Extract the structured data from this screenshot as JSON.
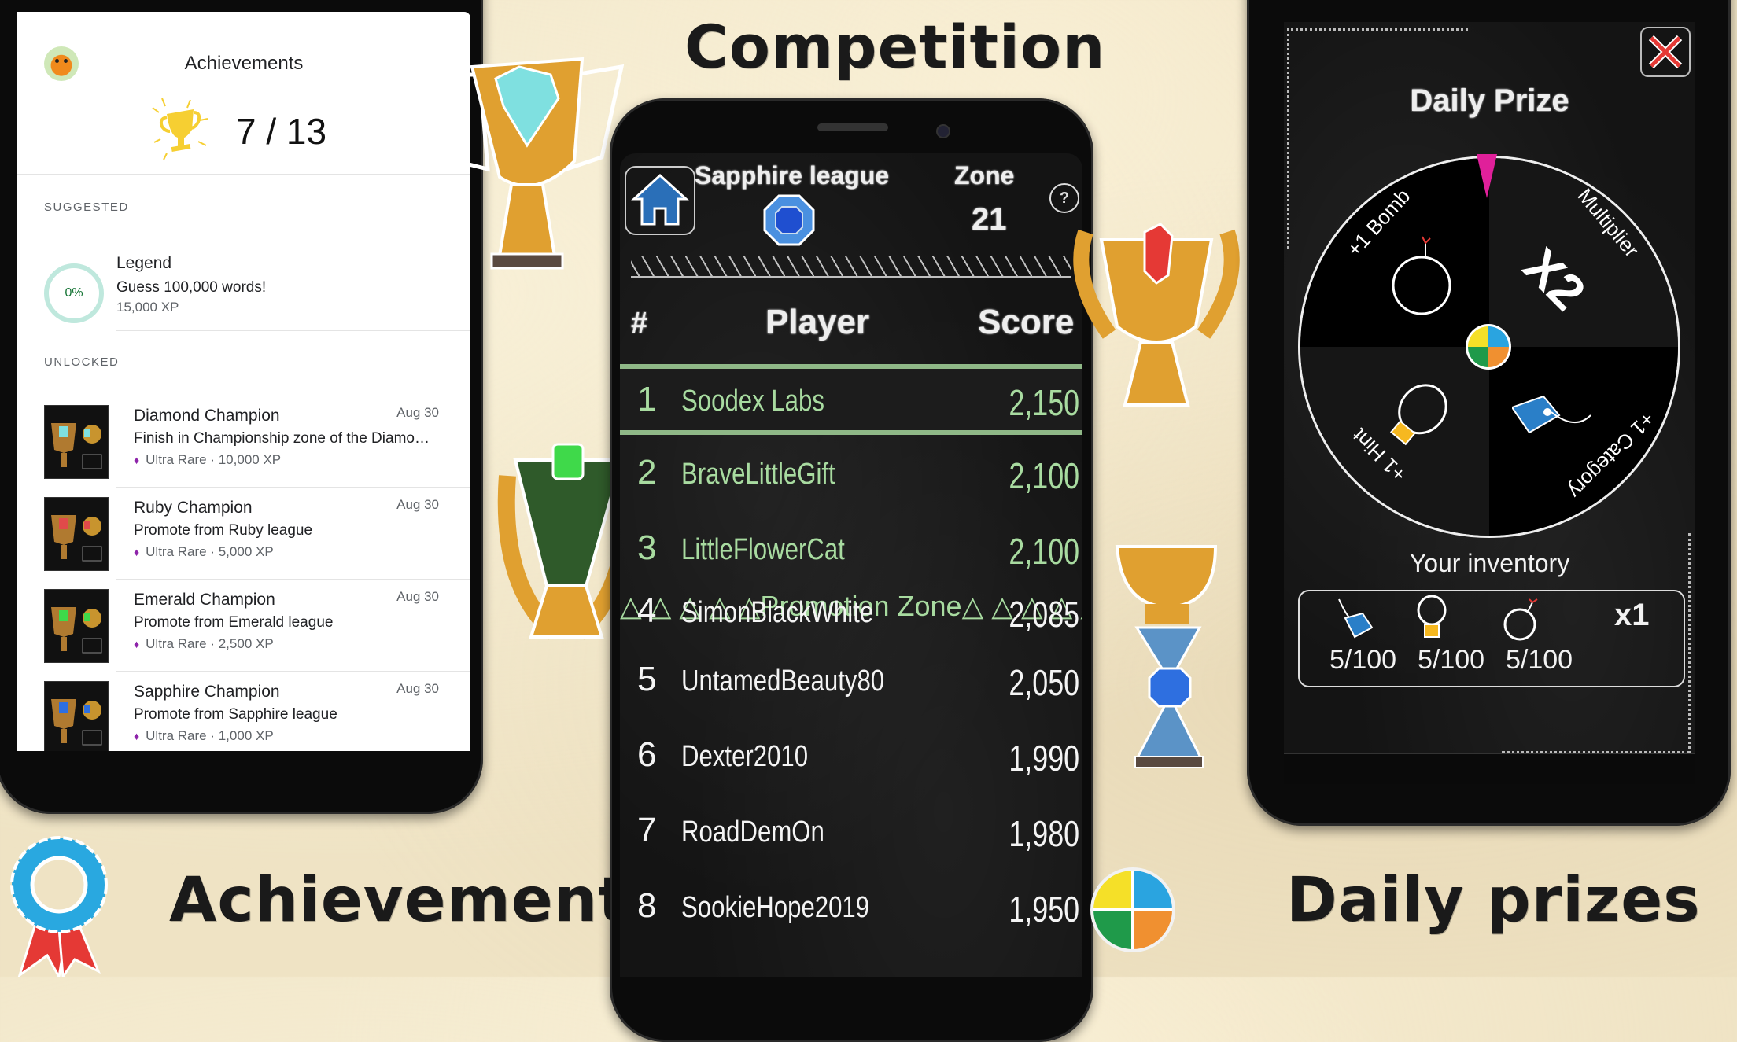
{
  "titles": {
    "competition": "Competition",
    "achievements": "Achievements",
    "daily_prizes": "Daily prizes"
  },
  "achievements_screen": {
    "header_title": "Achievements",
    "avatar_icon": "dragon-avatar",
    "unlocked_count": "7 / 13",
    "trophy_icon": "gold-trophy",
    "sections": {
      "suggested_label": "SUGGESTED",
      "unlocked_label": "UNLOCKED"
    },
    "suggested": {
      "progress_label": "0%",
      "progress_value": 0,
      "name": "Legend",
      "description": "Guess 100,000 words!",
      "xp": "15,000 XP"
    },
    "unlocked": [
      {
        "name": "Diamond Champion",
        "description": "Finish in Championship zone of the Diamo…",
        "meta": "Ultra Rare · 10,000 XP",
        "date": "Aug 30",
        "gem_color": "#7fe0e0"
      },
      {
        "name": "Ruby Champion",
        "description": "Promote from Ruby league",
        "meta": "Ultra Rare · 5,000 XP",
        "date": "Aug 30",
        "gem_color": "#e04a4a"
      },
      {
        "name": "Emerald Champion",
        "description": "Promote from Emerald league",
        "meta": "Ultra Rare · 2,500 XP",
        "date": "Aug 30",
        "gem_color": "#3fd94a"
      },
      {
        "name": "Sapphire Champion",
        "description": "Promote from Sapphire league",
        "meta": "Ultra Rare · 1,000 XP",
        "date": "Aug 30",
        "gem_color": "#2e6fe0"
      }
    ],
    "rarity_color": "#8e24aa"
  },
  "leaderboard_screen": {
    "league": "Sapphire league",
    "zone_label": "Zone",
    "zone_value": "21",
    "help_label": "?",
    "columns": {
      "rank": "#",
      "player": "Player",
      "score": "Score"
    },
    "promotion_zone_label": "△ △ △ △ △Promotion Zone△ △ △ △ △",
    "rows": [
      {
        "rank": "1",
        "player": "Soodex Labs",
        "score": "2,150",
        "highlight": true,
        "promoted": true
      },
      {
        "rank": "2",
        "player": "BraveLittleGift",
        "score": "2,100",
        "highlight": false,
        "promoted": true
      },
      {
        "rank": "3",
        "player": "LittleFlowerCat",
        "score": "2,100",
        "highlight": false,
        "promoted": true
      },
      {
        "rank": "4",
        "player": "SimonBlackWhite",
        "score": "2,085",
        "highlight": false,
        "promoted": false
      },
      {
        "rank": "5",
        "player": "UntamedBeauty80",
        "score": "2,050",
        "highlight": false,
        "promoted": false
      },
      {
        "rank": "6",
        "player": "Dexter2010",
        "score": "1,990",
        "highlight": false,
        "promoted": false
      },
      {
        "rank": "7",
        "player": "RoadDemOn",
        "score": "1,980",
        "highlight": false,
        "promoted": false
      },
      {
        "rank": "8",
        "player": "SookieHope2019",
        "score": "1,950",
        "highlight": false,
        "promoted": false
      }
    ],
    "accent_green": "#a8dba0"
  },
  "daily_prize_screen": {
    "title": "Daily Prize",
    "close_icon": "close-x",
    "wheel": {
      "segments": [
        {
          "label": "+1 Bomb",
          "icon": "bomb"
        },
        {
          "label": "Multiplier",
          "icon": "x2",
          "icon_text": "X2"
        },
        {
          "label": "+1 Category",
          "icon": "tag"
        },
        {
          "label": "+1 Hint",
          "icon": "lightbulb"
        }
      ],
      "pointer_color": "#e0209a"
    },
    "inventory_title": "Your inventory",
    "inventory": [
      {
        "icon": "tag",
        "count": "5/100"
      },
      {
        "icon": "lightbulb",
        "count": "5/100"
      },
      {
        "icon": "bomb",
        "count": "5/100"
      },
      {
        "icon": "multiplier",
        "count": "x1"
      }
    ]
  }
}
